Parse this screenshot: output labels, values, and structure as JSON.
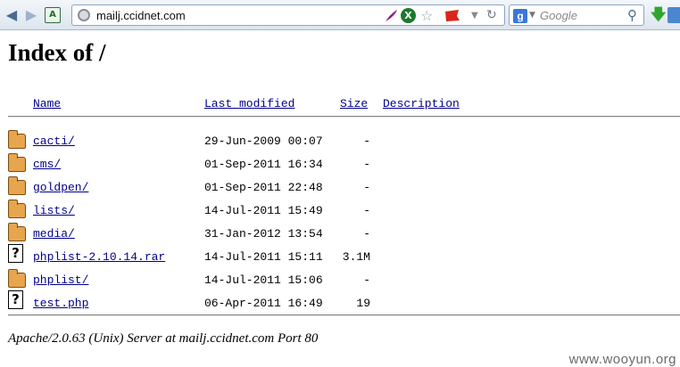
{
  "browser": {
    "url": "mailj.ccidnet.com",
    "search_placeholder": "Google",
    "search_engine_letter": "g"
  },
  "page": {
    "heading": "Index of /",
    "columns": {
      "name": "Name",
      "last_modified": "Last modified",
      "size": "Size",
      "description": "Description"
    },
    "entries": [
      {
        "icon": "folder-icon",
        "name": "cacti/",
        "modified": "29-Jun-2009 00:07",
        "size": "-"
      },
      {
        "icon": "folder-icon",
        "name": "cms/",
        "modified": "01-Sep-2011 16:34",
        "size": "-"
      },
      {
        "icon": "folder-icon",
        "name": "goldpen/",
        "modified": "01-Sep-2011 22:48",
        "size": "-"
      },
      {
        "icon": "folder-icon",
        "name": "lists/",
        "modified": "14-Jul-2011 15:49",
        "size": "-"
      },
      {
        "icon": "folder-icon",
        "name": "media/",
        "modified": "31-Jan-2012 13:54",
        "size": "-"
      },
      {
        "icon": "unknown-file-icon",
        "name": "phplist-2.10.14.rar",
        "modified": "14-Jul-2011 15:11",
        "size": "3.1M"
      },
      {
        "icon": "folder-icon",
        "name": "phplist/",
        "modified": "14-Jul-2011 15:06",
        "size": "-"
      },
      {
        "icon": "unknown-file-icon",
        "name": "test.php",
        "modified": "06-Apr-2011 16:49",
        "size": "19"
      }
    ],
    "footer": "Apache/2.0.63 (Unix) Server at mailj.ccidnet.com Port 80"
  },
  "watermark": "www.wooyun.org"
}
